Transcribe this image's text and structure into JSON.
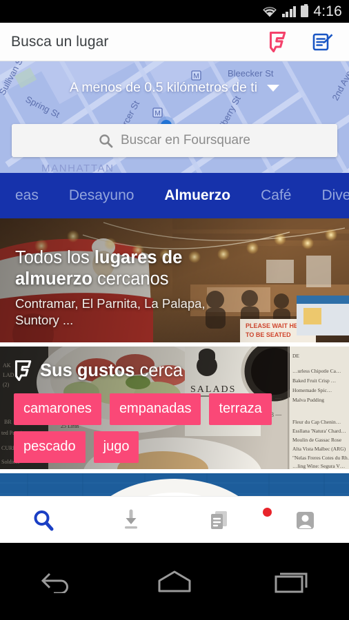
{
  "status_bar": {
    "time": "4:16",
    "icons": [
      "wifi-icon",
      "cellular-signal-icon",
      "battery-icon"
    ]
  },
  "header": {
    "title": "Busca un lugar",
    "actions": [
      {
        "name": "foursquare-logo-button",
        "icon": "foursquare-logo-icon",
        "color": "#f4426b"
      },
      {
        "name": "compose-tip-button",
        "icon": "compose-edit-icon",
        "color": "#1a56c4"
      }
    ]
  },
  "map": {
    "radius_label": "A menos de 0.5 kilómetros de ti",
    "chevron_icon": "chevron-down-icon",
    "street_labels": [
      "Spring St",
      "Mercer St",
      "Bleecker St",
      "Mulberry St",
      "2nd Ave",
      "Sullivan St",
      "MANHATTAN"
    ],
    "subway_markers": [
      "M",
      "M"
    ],
    "user_location_marker": "blue-dot",
    "base_color": "#a9bbe9",
    "road_color": "#c6d2f3"
  },
  "search": {
    "placeholder": "Buscar en Foursquare",
    "icon": "search-icon"
  },
  "tabs": {
    "accent_color": "#1632ab",
    "items": [
      {
        "label": "eas",
        "active": false
      },
      {
        "label": "Desayuno",
        "active": false
      },
      {
        "label": "Almuerzo",
        "active": true
      },
      {
        "label": "Café",
        "active": false
      },
      {
        "label": "Diversión",
        "active": false
      }
    ]
  },
  "feed": {
    "lunch_card": {
      "title_prefix": "Todos los ",
      "title_bold": "lugares de almuerzo",
      "title_suffix": " cercanos",
      "subtitle": "Contramar, El Parnita, La Palapa, Suntory ..."
    },
    "tastes_card": {
      "logo_icon": "foursquare-logo-icon",
      "title_bold": "Sus gustos",
      "title_rest": " cerca",
      "chip_color": "#fa4877",
      "chips": [
        "camarones",
        "empanadas",
        "terraza",
        "pescado",
        "jugo"
      ]
    },
    "fish_card": {
      "image_alt": "grilled-fish-on-plate"
    }
  },
  "bottom_nav": {
    "active_color": "#1a3fc4",
    "inactive_color": "#b3b3b3",
    "items": [
      {
        "name": "bottom-nav-search",
        "icon": "search-icon",
        "active": true
      },
      {
        "name": "bottom-nav-saved",
        "icon": "download-arrow-icon",
        "active": false
      },
      {
        "name": "bottom-nav-lists",
        "icon": "lists-stack-icon",
        "active": false
      },
      {
        "name": "bottom-nav-profile",
        "icon": "profile-avatar-icon",
        "active": false,
        "badge": true
      }
    ]
  },
  "android_nav": {
    "items": [
      {
        "name": "android-back-button",
        "icon": "back-arrow-icon"
      },
      {
        "name": "android-home-button",
        "icon": "home-icon"
      },
      {
        "name": "android-recents-button",
        "icon": "recents-icon"
      }
    ]
  }
}
